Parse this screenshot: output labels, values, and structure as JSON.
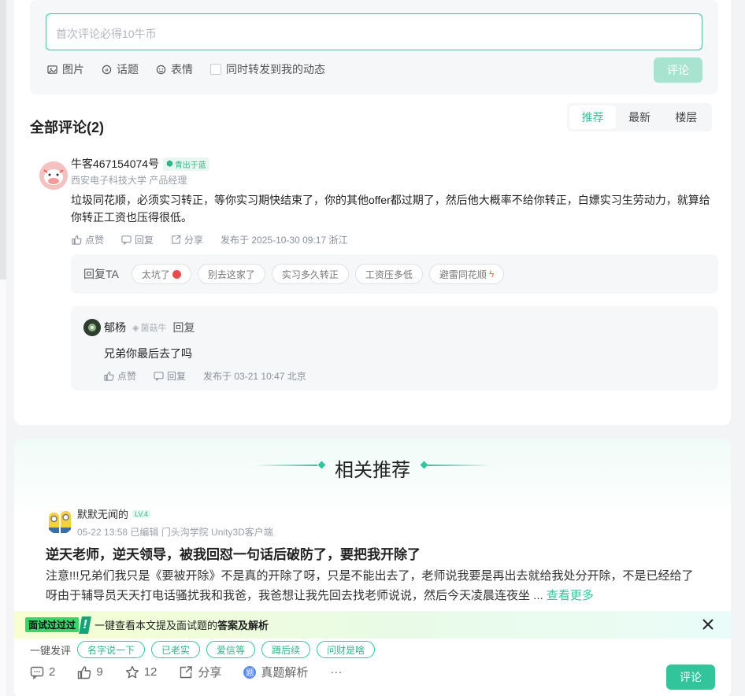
{
  "editor": {
    "placeholder": "首次评论必得10牛币",
    "tools": [
      "图片",
      "话题",
      "表情"
    ],
    "forward_label": "同时转发到我的动态",
    "submit": "评论"
  },
  "comments": {
    "title": "全部评论(2)",
    "tabs": [
      "推荐",
      "最新",
      "楼层"
    ]
  },
  "comment1": {
    "name": "牛客467154074号",
    "badge": "青出于蓝",
    "meta": "西安电子科技大学 产品经理",
    "text": "垃圾同花顺，必须实习转正，等你实习期快结束了，你的其他offer都过期了，然后他大概率不给你转正，白嫖实习生劳动力，就算给你转正工资也压得很低。",
    "like": "点赞",
    "reply": "回复",
    "share": "分享",
    "time": "发布于 2025-10-30 09:17 浙江"
  },
  "quick_reply": {
    "label": "回复TA",
    "chips": [
      "太坑了",
      "别去这家了",
      "实习多久转正",
      "工资压多低",
      "避雷同花顺"
    ]
  },
  "reply": {
    "name": "郁杨",
    "level": "菌菇牛",
    "reply_label": "回复",
    "text": "兄弟你最后去了吗",
    "like": "点赞",
    "reply": "回复",
    "time": "发布于 03-21 10:47 北京"
  },
  "related": {
    "title": "相关推荐",
    "author": "默默无闻的",
    "level": "LV.4",
    "meta": "05-22 13:58  已编辑  门头沟学院 Unity3D客户端",
    "post_title": "逆天老师，逆天领导，被我回怼一句话后破防了，要把我开除了",
    "body": "注意!!!兄弟们我只是《要被开除》不是真的开除了呀，只是不能出去了，老师说我要是再出去就给我处分开除，不是已经给了呀由于辅导员天天打电话骚扰我和我爸，我爸想让我先回去找老师说说，然后今天凌晨连夜坐 ...",
    "more": "查看更多"
  },
  "ai_bar": {
    "tag": "面试过过过",
    "mark": "!",
    "text": "一键查看本文提及面试题的",
    "strong": "答案及解析"
  },
  "rate": {
    "label": "一键发评",
    "chips": [
      "名字说一下",
      "已老实",
      "爱信等",
      "蹲后续",
      "问财是啥"
    ]
  },
  "bottom": {
    "comments": "2",
    "likes": "9",
    "stars": "12",
    "share": "分享",
    "analysis_icon": "题",
    "analysis": "真题解析",
    "more": "···",
    "submit": "评论"
  },
  "colors": {
    "accent": "#32c49b",
    "accent_light": "#a8e3d0"
  }
}
